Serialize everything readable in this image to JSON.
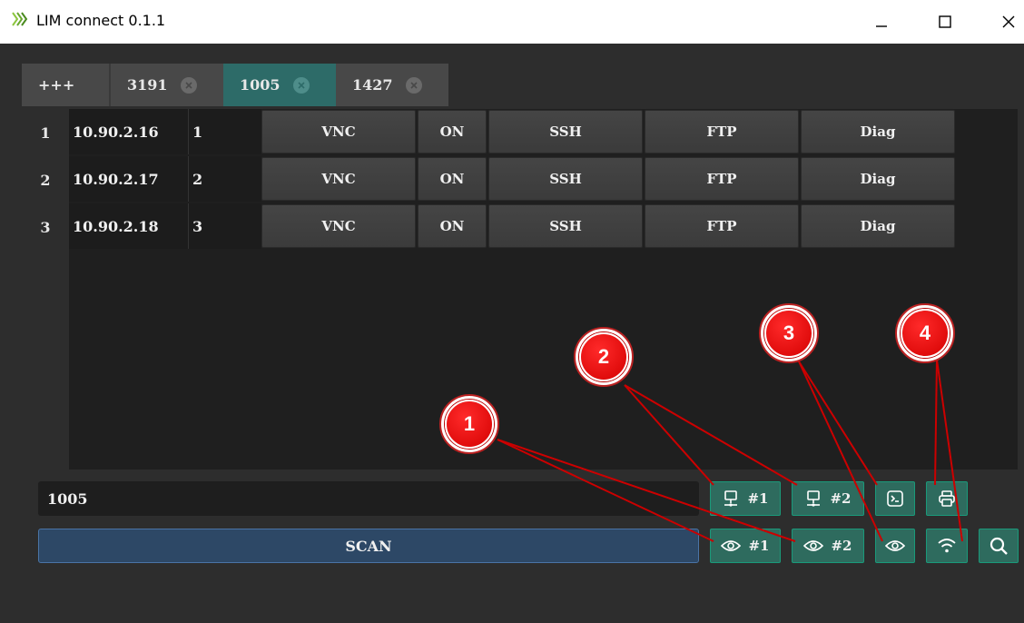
{
  "window": {
    "title": "LIM connect 0.1.1",
    "minimize_glyph": "—",
    "maximize_glyph": "☐",
    "close_glyph": "✕"
  },
  "tabs": [
    {
      "label": "+++",
      "active": false,
      "closable": false
    },
    {
      "label": "3191",
      "active": false,
      "closable": true
    },
    {
      "label": "1005",
      "active": true,
      "closable": true
    },
    {
      "label": "1427",
      "active": false,
      "closable": true
    }
  ],
  "rows": [
    {
      "num": "1",
      "ip": "10.90.2.16",
      "id": "1",
      "vnc": "VNC",
      "on": "ON",
      "ssh": "SSH",
      "ftp": "FTP",
      "diag": "Diag"
    },
    {
      "num": "2",
      "ip": "10.90.2.17",
      "id": "2",
      "vnc": "VNC",
      "on": "ON",
      "ssh": "SSH",
      "ftp": "FTP",
      "diag": "Diag"
    },
    {
      "num": "3",
      "ip": "10.90.2.18",
      "id": "3",
      "vnc": "VNC",
      "on": "ON",
      "ssh": "SSH",
      "ftp": "FTP",
      "diag": "Diag"
    }
  ],
  "session_field": {
    "value": "1005"
  },
  "scan_label": "SCAN",
  "toolbar": {
    "network1_label": "#1",
    "network2_label": "#2",
    "view1_label": "#1",
    "view2_label": "#2"
  },
  "annotations": [
    "1",
    "2",
    "3",
    "4"
  ],
  "colors": {
    "accent_teal": "#2d6b68",
    "button_green": "#2e6b5e",
    "scan_blue": "#2d4866",
    "badge_red": "#e00000",
    "annotation_line": "#cc0000"
  }
}
